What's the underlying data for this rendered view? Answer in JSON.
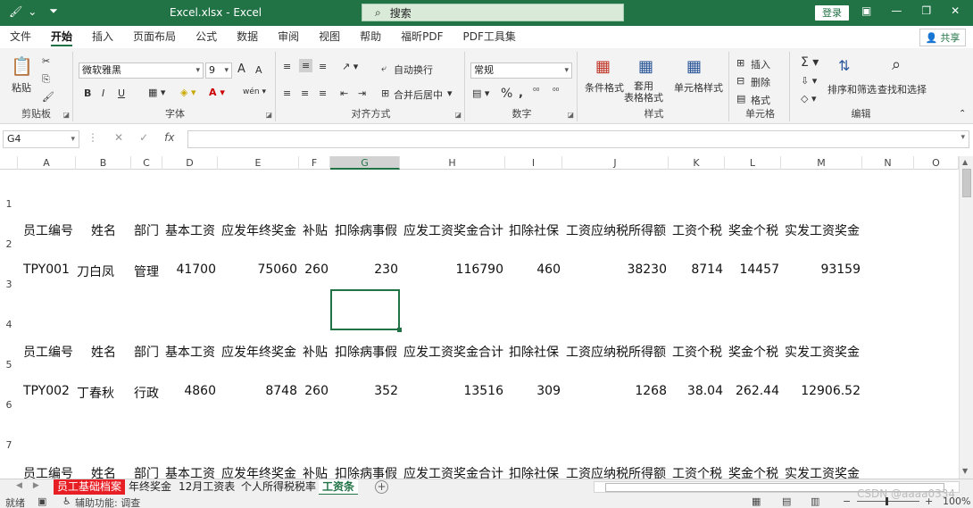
{
  "window": {
    "title": "Excel.xlsx  -  Excel",
    "search_placeholder": "搜索",
    "login_label": "登录",
    "share_label": "共享",
    "brand_color": "#217346"
  },
  "menu": [
    "文件",
    "开始",
    "插入",
    "页面布局",
    "公式",
    "数据",
    "审阅",
    "视图",
    "帮助",
    "福昕PDF",
    "PDF工具集"
  ],
  "ribbon": {
    "clipboard": {
      "paste": "粘贴",
      "group": "剪贴板"
    },
    "font": {
      "name": "微软雅黑",
      "size": "9",
      "group": "字体",
      "bold": "B",
      "italic": "I",
      "underline": "U",
      "grow": "A",
      "shrink": "A"
    },
    "alignment": {
      "wrap": "自动换行",
      "merge": "合并后居中",
      "group": "对齐方式"
    },
    "number": {
      "format": "常规",
      "group": "数字"
    },
    "styles": {
      "conditional": "条件格式",
      "table": "套用\n表格格式",
      "cell": "单元格样式",
      "group": "样式"
    },
    "cells": {
      "insert": "插入",
      "delete": "删除",
      "format": "格式",
      "group": "单元格"
    },
    "editing": {
      "sort": "排序和筛选",
      "find": "查找和选择",
      "group": "编辑"
    }
  },
  "formula_bar": {
    "name_box": "G4",
    "fx": "fx",
    "value": ""
  },
  "columns": [
    "A",
    "B",
    "C",
    "D",
    "E",
    "F",
    "G",
    "H",
    "I",
    "J",
    "K",
    "L",
    "M",
    "N",
    "O"
  ],
  "selected_column": "G",
  "rows": [
    "1",
    "2",
    "3",
    "4",
    "5",
    "6",
    "7"
  ],
  "header_labels": [
    "员工编号",
    "姓名",
    "部门",
    "基本工资",
    "应发年终奖金",
    "补贴",
    "扣除病事假",
    "应发工资奖金合计",
    "扣除社保",
    "工资应纳税所得额",
    "工资个税",
    "奖金个税",
    "实发工资奖金"
  ],
  "records": [
    [
      "TPY001",
      "刀白凤",
      "管理",
      "41700",
      "75060",
      "260",
      "230",
      "116790",
      "460",
      "38230",
      "8714",
      "14457",
      "93159"
    ],
    [
      "TPY002",
      "丁春秋",
      "行政",
      "4860",
      "8748",
      "260",
      "352",
      "13516",
      "309",
      "1268",
      "38.04",
      "262.44",
      "12906.52"
    ]
  ],
  "sheets": [
    "员工基础档案",
    "年终奖金",
    "12月工资表",
    "个人所得税税率",
    "工资条"
  ],
  "active_sheet": "工资条",
  "status": {
    "ready": "就绪",
    "accessibility": "辅助功能: 调查",
    "zoom": "100%"
  },
  "watermark": "CSDN @aaaa0334"
}
